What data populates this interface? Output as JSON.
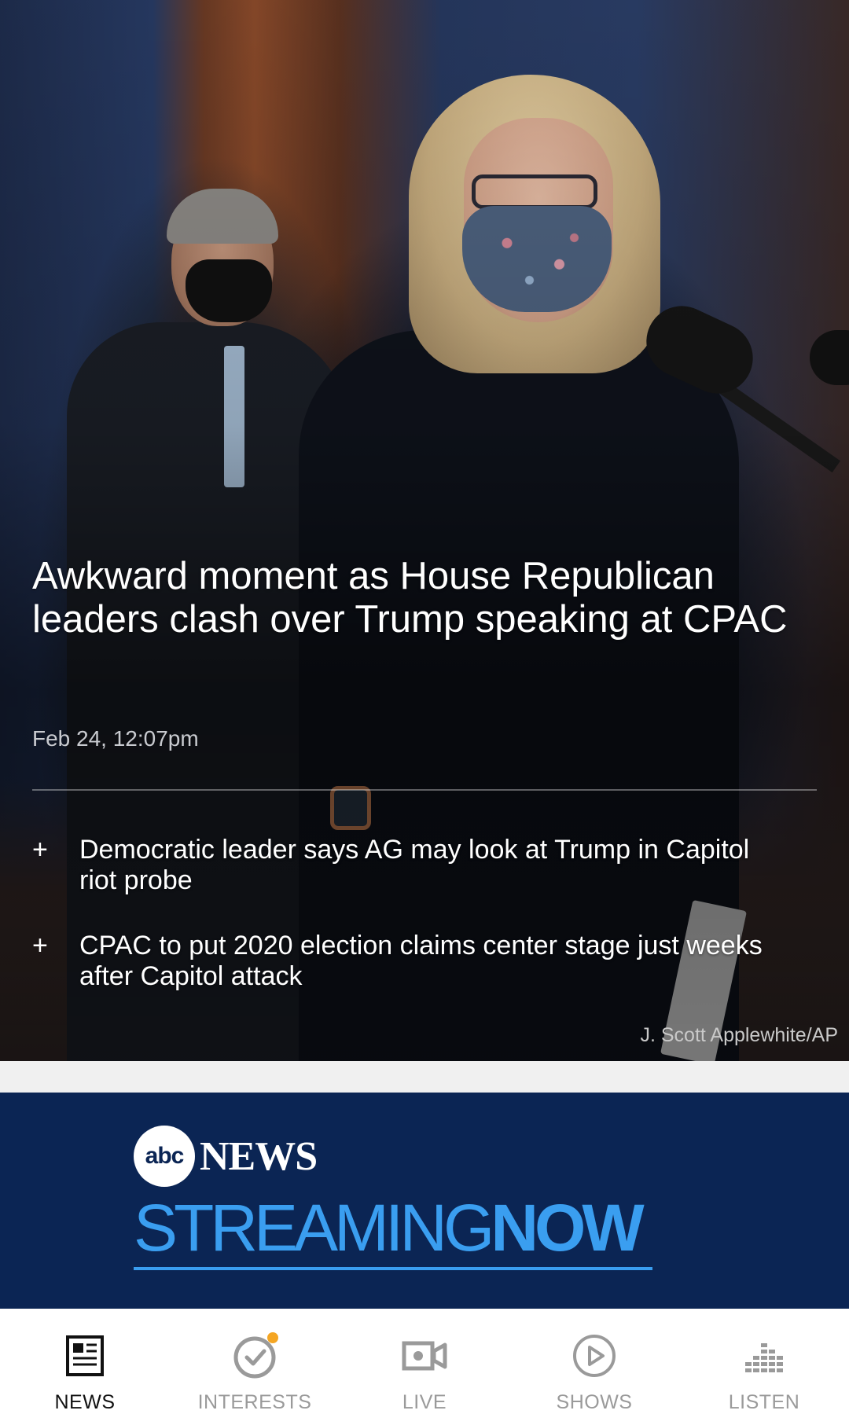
{
  "hero": {
    "headline": "Awkward moment as House Republican leaders clash over Trump speaking at CPAC",
    "timestamp": "Feb 24, 12:07pm",
    "related": [
      {
        "prefix": "+",
        "text": "Democratic leader says AG may look at Trump in Capitol riot probe"
      },
      {
        "prefix": "+",
        "text": "CPAC to put 2020 election claims center stage just weeks after Capitol attack"
      }
    ],
    "photo_credit": "J. Scott Applewhite/AP"
  },
  "banner": {
    "abc_logo": "abc",
    "news_word": "NEWS",
    "streaming_word": "STREAMING",
    "now_word": "NOW",
    "colors": {
      "background": "#0b2554",
      "accent": "#3a9ef0"
    }
  },
  "bottom_nav": {
    "items": [
      {
        "label": "NEWS",
        "icon": "newspaper-icon",
        "active": true
      },
      {
        "label": "INTERESTS",
        "icon": "check-circle-icon",
        "active": false,
        "notification": true
      },
      {
        "label": "LIVE",
        "icon": "video-camera-icon",
        "active": false
      },
      {
        "label": "SHOWS",
        "icon": "play-circle-icon",
        "active": false
      },
      {
        "label": "LISTEN",
        "icon": "audio-bars-icon",
        "active": false
      }
    ],
    "colors": {
      "active": "#111111",
      "inactive": "#9a9a9a",
      "notification": "#f5a623"
    }
  }
}
